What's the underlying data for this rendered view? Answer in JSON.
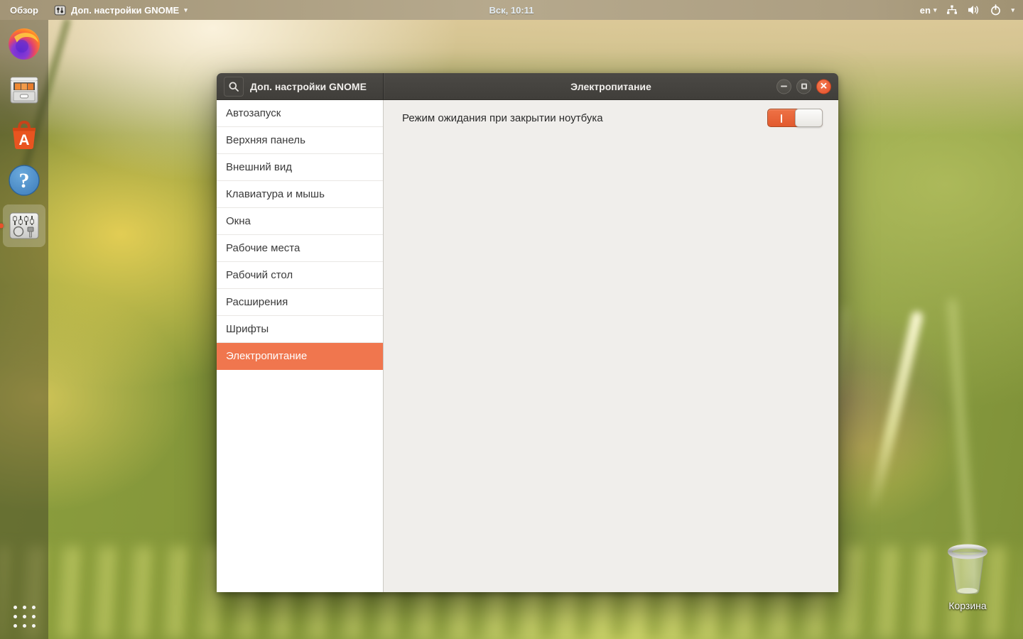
{
  "topbar": {
    "activities": "Обзор",
    "app_title": "Доп. настройки GNOME",
    "chevron": "▾",
    "clock": "Вск, 10:11",
    "language": "en"
  },
  "window": {
    "titlebar": {
      "left_title": "Доп. настройки GNOME",
      "right_title": "Электропитание",
      "close_glyph": "✕"
    },
    "sidebar": {
      "items": [
        "Автозапуск",
        "Верхняя панель",
        "Внешний вид",
        "Клавиатура и мышь",
        "Окна",
        "Рабочие места",
        "Рабочий стол",
        "Расширения",
        "Шрифты",
        "Электропитание"
      ],
      "selected": "Электропитание"
    },
    "content": {
      "setting_label": "Режим ожидания при закрытии ноутбука",
      "toggle_state": "on"
    }
  },
  "dock": {
    "items": [
      "firefox",
      "files",
      "ubuntu-software",
      "help",
      "gnome-tweaks"
    ],
    "active_item": "gnome-tweaks"
  },
  "desktop": {
    "trash_label": "Корзина"
  },
  "colors": {
    "accent_orange": "#E95420",
    "selected_row": "#F0764E",
    "titlebar_bg": "#454340",
    "topbar_bg": "#AC9E81",
    "sidebar_bg": "#FFFFFF",
    "content_bg": "#F0EEEB"
  }
}
